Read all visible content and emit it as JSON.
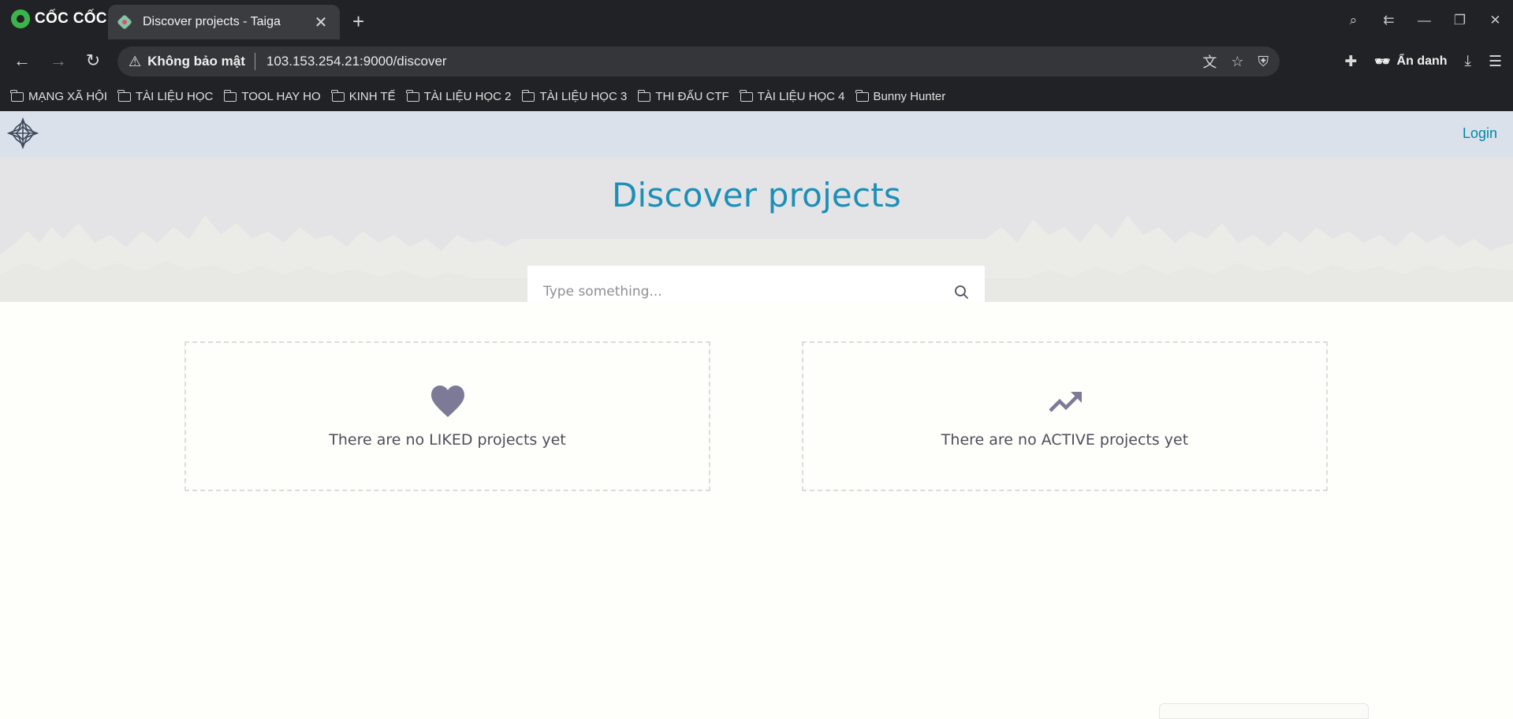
{
  "browser": {
    "name": "CỐC CỐC",
    "tab": {
      "title": "Discover projects - Taiga"
    },
    "new_tab": "+",
    "security_label": "Không bảo mật",
    "url": "103.153.254.21:9000/discover",
    "profile_label": "Ẩn danh",
    "bookmarks": [
      "MẠNG XÃ HỘI",
      "TÀI LIỆU HỌC",
      "TOOL HAY HO",
      "KINH TẾ",
      "TÀI LIỆU HỌC 2",
      "TÀI LIỆU HỌC 3",
      "THI ĐẤU CTF",
      "TÀI LIỆU HỌC 4",
      "Bunny Hunter"
    ]
  },
  "app": {
    "header": {
      "login_label": "Login"
    },
    "hero": {
      "title": "Discover projects",
      "search_placeholder": "Type something..."
    },
    "cards": {
      "liked": {
        "text": "There are no LIKED projects yet",
        "icon": "heart-icon"
      },
      "active": {
        "text": "There are no ACTIVE projects yet",
        "icon": "trending-up-icon"
      }
    }
  },
  "colors": {
    "accent": "#1c8fb8",
    "login_link": "#008aa8",
    "icon": "#7c7a96",
    "header_bg": "#dbe1ea",
    "chrome_bg": "#212225"
  }
}
